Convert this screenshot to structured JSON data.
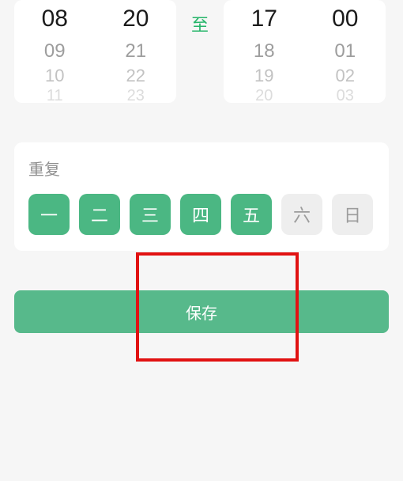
{
  "picker": {
    "separator": "至",
    "start": {
      "hour": {
        "selected": "08",
        "next1": "09",
        "next2": "10",
        "next3": "11"
      },
      "minute": {
        "selected": "20",
        "next1": "21",
        "next2": "22",
        "next3": "23"
      }
    },
    "end": {
      "hour": {
        "selected": "17",
        "next1": "18",
        "next2": "19",
        "next3": "20"
      },
      "minute": {
        "selected": "00",
        "next1": "01",
        "next2": "02",
        "next3": "03"
      }
    }
  },
  "repeat": {
    "title": "重复",
    "days": [
      {
        "label": "一",
        "selected": true
      },
      {
        "label": "二",
        "selected": true
      },
      {
        "label": "三",
        "selected": true
      },
      {
        "label": "四",
        "selected": true
      },
      {
        "label": "五",
        "selected": true
      },
      {
        "label": "六",
        "selected": false
      },
      {
        "label": "日",
        "selected": false
      }
    ]
  },
  "save_label": "保存"
}
